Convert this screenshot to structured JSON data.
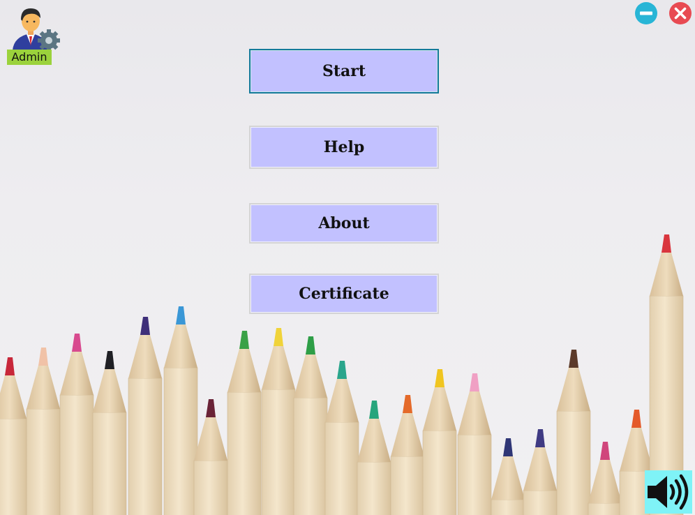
{
  "user": {
    "label": "Admin",
    "icon": "admin-user-gear-icon"
  },
  "window_controls": {
    "minimize_icon": "minus-circle-icon",
    "close_icon": "close-x-circle-icon"
  },
  "menu": {
    "start_label": "Start",
    "help_label": "Help",
    "about_label": "About",
    "certificate_label": "Certificate"
  },
  "sound": {
    "icon": "speaker-volume-icon"
  },
  "colors": {
    "button_fill": "#c2c1ff",
    "focus_border": "#147a9a",
    "admin_badge": "#9bd23c",
    "minimize": "#28b5d6",
    "close": "#e84a52",
    "sound_bg": "#7ff3f7"
  }
}
